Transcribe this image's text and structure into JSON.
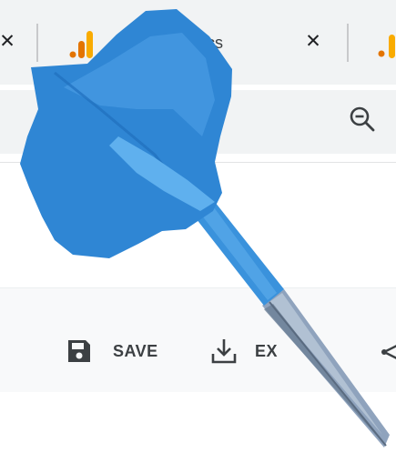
{
  "browser": {
    "tabs": [
      {
        "title": "",
        "close_glyph": "✕",
        "favicon": "analytics-logo-icon"
      },
      {
        "title": "cs",
        "close_glyph": "✕",
        "favicon": "analytics-logo-icon"
      }
    ],
    "omnibox": {
      "right_icon": "zoom-out-icon"
    }
  },
  "toolbar": {
    "save": {
      "label": "SAVE",
      "icon": "save-disk-icon"
    },
    "export": {
      "label": "EX",
      "icon": "download-icon"
    },
    "share": {
      "icon": "share-icon"
    }
  },
  "overlay": {
    "icon": "dart-icon",
    "colors": {
      "flight": "#2f86d4",
      "shaft": "#3a92dc",
      "barrel": "#8fa3bd"
    }
  },
  "colors": {
    "tab_strip": "#f1f3f4",
    "analytics_orange": "#f9ab00",
    "analytics_dark_orange": "#e37400",
    "toolbar_bg": "#f8f9fa"
  }
}
